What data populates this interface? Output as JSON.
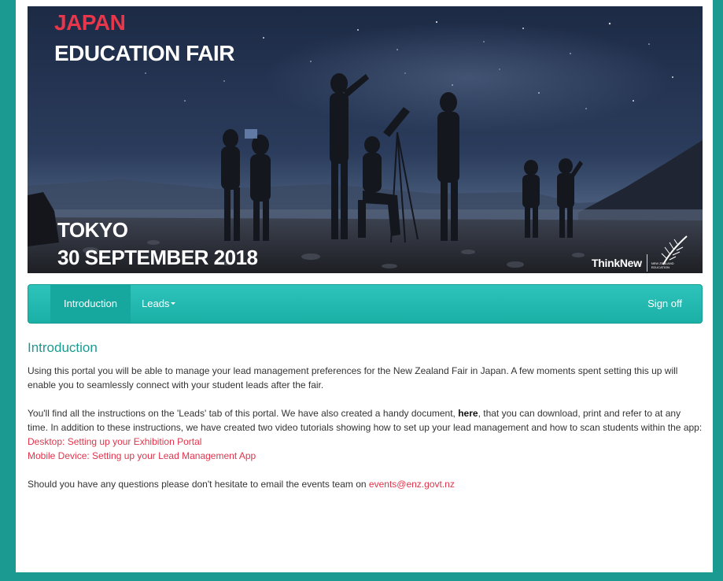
{
  "banner": {
    "line1": "JAPAN",
    "line2": "EDUCATION FAIR",
    "city": "TOKYO",
    "date": "30 SEPTEMBER 2018",
    "brand_think": "Think",
    "brand_new": "New",
    "brand_nz": "NEW ZEALAND EDUCATION",
    "fern_icon": "silver-fern-icon"
  },
  "nav": {
    "introduction": "Introduction",
    "leads": "Leads",
    "sign_off": "Sign off"
  },
  "content": {
    "heading": "Introduction",
    "p1": "Using this portal you will be able to manage your lead management preferences for the New Zealand Fair in Japan. A few moments spent setting this up will enable you to seamlessly connect with your student leads after the fair.",
    "p2_a": "You'll find all the instructions on the 'Leads' tab of this portal. We have also created a handy document, ",
    "p2_link": "here",
    "p2_b": ", that you can download, print and refer to at any time. In addition to these instructions, we have created two video tutorials showing how to set up your lead management and how to scan students within the app:",
    "link_desktop": "Desktop: Setting up your Exhibition Portal",
    "link_mobile": "Mobile Device: Setting up your Lead Management App",
    "p3_a": "Should you have any questions please don't hesitate to email the events team on ",
    "p3_email": "events@enz.govt.nz"
  },
  "colors": {
    "teal": "#1a9a90",
    "navbar": "#1ab0a6",
    "link": "#e0344b",
    "japan_red": "#e8364a"
  }
}
